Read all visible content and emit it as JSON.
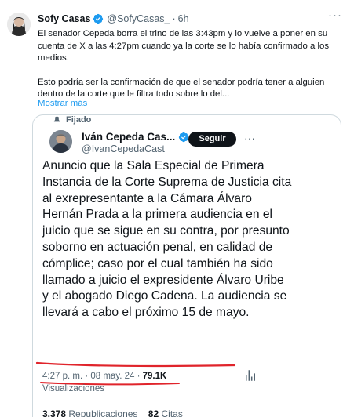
{
  "author": {
    "name": "Sofy Casas",
    "handle": "@SofyCasas_",
    "separator": "·",
    "time": "6h"
  },
  "tweet": {
    "paragraph1": "El senador Cepeda borra el trino de las 3:43pm y lo vuelve a poner en su cuenta de X a las 4:27pm cuando ya la corte se lo había confirmado a los medios.",
    "paragraph2": "Esto podría ser la confirmación de que el senador podría tener a alguien dentro de la corte que le filtra todo sobre lo del...",
    "show_more": "Mostrar más"
  },
  "quoted": {
    "pinned_label": "Fijado",
    "name": "Iván Cepeda Cas...",
    "handle": "@IvanCepedaCast",
    "follow_label": "Seguir",
    "text": "Anuncio que la Sala Especial de Primera Instancia de la Corte Suprema de Justicia cita al exrepresentante a la Cámara Álvaro Hernán Prada a la primera audiencia en el juicio que se sigue en su contra, por presunto soborno en actuación penal, en calidad de cómplice; caso por el cual también ha sido llamado a juicio el expresidente Álvaro Uribe y el abogado Diego Cadena. La audiencia se llevará a cabo el próximo 15 de mayo.",
    "time": "4:27 p. m. · 08 may. 24 ·",
    "views_count": "79.1K",
    "views_label": "Visualizaciones",
    "reposts_count": "3.378",
    "reposts_label": "Republicaciones",
    "quotes_count": "82",
    "quotes_label": "Citas"
  },
  "icons": {
    "verified": "verified-badge-icon",
    "more": "more-icon",
    "pin": "pin-icon",
    "stats": "analytics-icon"
  },
  "colors": {
    "accent": "#1d9bf0",
    "annotation": "#e0242b",
    "muted": "#536471"
  }
}
